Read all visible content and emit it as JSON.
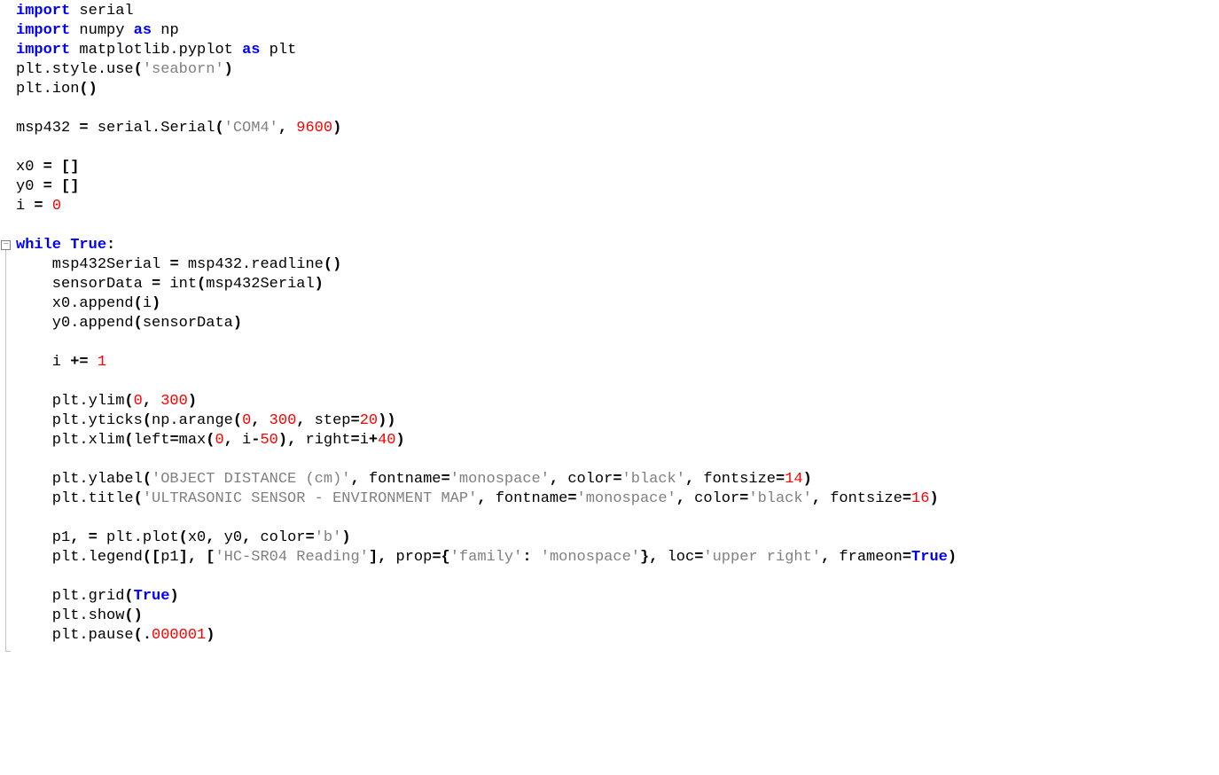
{
  "lines": [
    {
      "tokens": [
        {
          "t": "import",
          "c": "kw"
        },
        {
          "t": " serial",
          "c": "id"
        }
      ]
    },
    {
      "tokens": [
        {
          "t": "import",
          "c": "kw"
        },
        {
          "t": " numpy ",
          "c": "id"
        },
        {
          "t": "as",
          "c": "kw-as"
        },
        {
          "t": " np",
          "c": "id"
        }
      ]
    },
    {
      "tokens": [
        {
          "t": "import",
          "c": "kw"
        },
        {
          "t": " matplotlib.pyplot ",
          "c": "id"
        },
        {
          "t": "as",
          "c": "kw-as"
        },
        {
          "t": " plt",
          "c": "id"
        }
      ]
    },
    {
      "tokens": [
        {
          "t": "plt.style.use",
          "c": "id"
        },
        {
          "t": "(",
          "c": "punc"
        },
        {
          "t": "'seaborn'",
          "c": "str"
        },
        {
          "t": ")",
          "c": "punc"
        }
      ]
    },
    {
      "tokens": [
        {
          "t": "plt.ion",
          "c": "id"
        },
        {
          "t": "()",
          "c": "punc"
        }
      ]
    },
    {
      "tokens": []
    },
    {
      "tokens": [
        {
          "t": "msp432 ",
          "c": "id"
        },
        {
          "t": "=",
          "c": "punc"
        },
        {
          "t": " serial.Serial",
          "c": "id"
        },
        {
          "t": "(",
          "c": "punc"
        },
        {
          "t": "'COM4'",
          "c": "str"
        },
        {
          "t": ",",
          "c": "punc"
        },
        {
          "t": " ",
          "c": "id"
        },
        {
          "t": "9600",
          "c": "num"
        },
        {
          "t": ")",
          "c": "punc"
        }
      ]
    },
    {
      "tokens": []
    },
    {
      "tokens": [
        {
          "t": "x0 ",
          "c": "id"
        },
        {
          "t": "=",
          "c": "punc"
        },
        {
          "t": " ",
          "c": "id"
        },
        {
          "t": "[]",
          "c": "punc"
        }
      ]
    },
    {
      "tokens": [
        {
          "t": "y0 ",
          "c": "id"
        },
        {
          "t": "=",
          "c": "punc"
        },
        {
          "t": " ",
          "c": "id"
        },
        {
          "t": "[]",
          "c": "punc"
        }
      ]
    },
    {
      "tokens": [
        {
          "t": "i ",
          "c": "id"
        },
        {
          "t": "=",
          "c": "punc"
        },
        {
          "t": " ",
          "c": "id"
        },
        {
          "t": "0",
          "c": "num"
        }
      ]
    },
    {
      "tokens": []
    },
    {
      "fold": true,
      "tokens": [
        {
          "t": "while",
          "c": "kw"
        },
        {
          "t": " ",
          "c": "id"
        },
        {
          "t": "True",
          "c": "bool"
        },
        {
          "t": ":",
          "c": "punc"
        }
      ]
    },
    {
      "tokens": [
        {
          "t": "    msp432Serial ",
          "c": "id"
        },
        {
          "t": "=",
          "c": "punc"
        },
        {
          "t": " msp432.readline",
          "c": "id"
        },
        {
          "t": "()",
          "c": "punc"
        }
      ]
    },
    {
      "tokens": [
        {
          "t": "    sensorData ",
          "c": "id"
        },
        {
          "t": "=",
          "c": "punc"
        },
        {
          "t": " int",
          "c": "id"
        },
        {
          "t": "(",
          "c": "punc"
        },
        {
          "t": "msp432Serial",
          "c": "id"
        },
        {
          "t": ")",
          "c": "punc"
        }
      ]
    },
    {
      "tokens": [
        {
          "t": "    x0.append",
          "c": "id"
        },
        {
          "t": "(",
          "c": "punc"
        },
        {
          "t": "i",
          "c": "id"
        },
        {
          "t": ")",
          "c": "punc"
        }
      ]
    },
    {
      "tokens": [
        {
          "t": "    y0.append",
          "c": "id"
        },
        {
          "t": "(",
          "c": "punc"
        },
        {
          "t": "sensorData",
          "c": "id"
        },
        {
          "t": ")",
          "c": "punc"
        }
      ]
    },
    {
      "tokens": []
    },
    {
      "tokens": [
        {
          "t": "    i ",
          "c": "id"
        },
        {
          "t": "+=",
          "c": "punc"
        },
        {
          "t": " ",
          "c": "id"
        },
        {
          "t": "1",
          "c": "num"
        }
      ]
    },
    {
      "tokens": []
    },
    {
      "tokens": [
        {
          "t": "    plt.ylim",
          "c": "id"
        },
        {
          "t": "(",
          "c": "punc"
        },
        {
          "t": "0",
          "c": "num"
        },
        {
          "t": ",",
          "c": "punc"
        },
        {
          "t": " ",
          "c": "id"
        },
        {
          "t": "300",
          "c": "num"
        },
        {
          "t": ")",
          "c": "punc"
        }
      ]
    },
    {
      "tokens": [
        {
          "t": "    plt.yticks",
          "c": "id"
        },
        {
          "t": "(",
          "c": "punc"
        },
        {
          "t": "np.arange",
          "c": "id"
        },
        {
          "t": "(",
          "c": "punc"
        },
        {
          "t": "0",
          "c": "num"
        },
        {
          "t": ",",
          "c": "punc"
        },
        {
          "t": " ",
          "c": "id"
        },
        {
          "t": "300",
          "c": "num"
        },
        {
          "t": ",",
          "c": "punc"
        },
        {
          "t": " step",
          "c": "id"
        },
        {
          "t": "=",
          "c": "punc"
        },
        {
          "t": "20",
          "c": "num"
        },
        {
          "t": "))",
          "c": "punc"
        }
      ]
    },
    {
      "tokens": [
        {
          "t": "    plt.xlim",
          "c": "id"
        },
        {
          "t": "(",
          "c": "punc"
        },
        {
          "t": "left",
          "c": "id"
        },
        {
          "t": "=",
          "c": "punc"
        },
        {
          "t": "max",
          "c": "id"
        },
        {
          "t": "(",
          "c": "punc"
        },
        {
          "t": "0",
          "c": "num"
        },
        {
          "t": ",",
          "c": "punc"
        },
        {
          "t": " i",
          "c": "id"
        },
        {
          "t": "-",
          "c": "punc"
        },
        {
          "t": "50",
          "c": "num"
        },
        {
          "t": "),",
          "c": "punc"
        },
        {
          "t": " right",
          "c": "id"
        },
        {
          "t": "=",
          "c": "punc"
        },
        {
          "t": "i",
          "c": "id"
        },
        {
          "t": "+",
          "c": "punc"
        },
        {
          "t": "40",
          "c": "num"
        },
        {
          "t": ")",
          "c": "punc"
        }
      ]
    },
    {
      "tokens": []
    },
    {
      "tokens": [
        {
          "t": "    plt.ylabel",
          "c": "id"
        },
        {
          "t": "(",
          "c": "punc"
        },
        {
          "t": "'OBJECT DISTANCE (cm)'",
          "c": "str"
        },
        {
          "t": ",",
          "c": "punc"
        },
        {
          "t": " fontname",
          "c": "id"
        },
        {
          "t": "=",
          "c": "punc"
        },
        {
          "t": "'monospace'",
          "c": "str"
        },
        {
          "t": ",",
          "c": "punc"
        },
        {
          "t": " color",
          "c": "id"
        },
        {
          "t": "=",
          "c": "punc"
        },
        {
          "t": "'black'",
          "c": "str"
        },
        {
          "t": ",",
          "c": "punc"
        },
        {
          "t": " fontsize",
          "c": "id"
        },
        {
          "t": "=",
          "c": "punc"
        },
        {
          "t": "14",
          "c": "num"
        },
        {
          "t": ")",
          "c": "punc"
        }
      ]
    },
    {
      "tokens": [
        {
          "t": "    plt.title",
          "c": "id"
        },
        {
          "t": "(",
          "c": "punc"
        },
        {
          "t": "'ULTRASONIC SENSOR - ENVIRONMENT MAP'",
          "c": "str"
        },
        {
          "t": ",",
          "c": "punc"
        },
        {
          "t": " fontname",
          "c": "id"
        },
        {
          "t": "=",
          "c": "punc"
        },
        {
          "t": "'monospace'",
          "c": "str"
        },
        {
          "t": ",",
          "c": "punc"
        },
        {
          "t": " color",
          "c": "id"
        },
        {
          "t": "=",
          "c": "punc"
        },
        {
          "t": "'black'",
          "c": "str"
        },
        {
          "t": ",",
          "c": "punc"
        },
        {
          "t": " fontsize",
          "c": "id"
        },
        {
          "t": "=",
          "c": "punc"
        },
        {
          "t": "16",
          "c": "num"
        },
        {
          "t": ")",
          "c": "punc"
        }
      ]
    },
    {
      "tokens": []
    },
    {
      "tokens": [
        {
          "t": "    p1",
          "c": "id"
        },
        {
          "t": ",",
          "c": "punc"
        },
        {
          "t": " ",
          "c": "id"
        },
        {
          "t": "=",
          "c": "punc"
        },
        {
          "t": " plt.plot",
          "c": "id"
        },
        {
          "t": "(",
          "c": "punc"
        },
        {
          "t": "x0",
          "c": "id"
        },
        {
          "t": ",",
          "c": "punc"
        },
        {
          "t": " y0",
          "c": "id"
        },
        {
          "t": ",",
          "c": "punc"
        },
        {
          "t": " color",
          "c": "id"
        },
        {
          "t": "=",
          "c": "punc"
        },
        {
          "t": "'b'",
          "c": "str"
        },
        {
          "t": ")",
          "c": "punc"
        }
      ]
    },
    {
      "tokens": [
        {
          "t": "    plt.legend",
          "c": "id"
        },
        {
          "t": "([",
          "c": "punc"
        },
        {
          "t": "p1",
          "c": "id"
        },
        {
          "t": "],",
          "c": "punc"
        },
        {
          "t": " ",
          "c": "id"
        },
        {
          "t": "[",
          "c": "punc"
        },
        {
          "t": "'HC-SR04 Reading'",
          "c": "str"
        },
        {
          "t": "],",
          "c": "punc"
        },
        {
          "t": " prop",
          "c": "id"
        },
        {
          "t": "={",
          "c": "punc"
        },
        {
          "t": "'family'",
          "c": "str"
        },
        {
          "t": ":",
          "c": "punc"
        },
        {
          "t": " ",
          "c": "id"
        },
        {
          "t": "'monospace'",
          "c": "str"
        },
        {
          "t": "},",
          "c": "punc"
        },
        {
          "t": " loc",
          "c": "id"
        },
        {
          "t": "=",
          "c": "punc"
        },
        {
          "t": "'upper right'",
          "c": "str"
        },
        {
          "t": ",",
          "c": "punc"
        },
        {
          "t": " frameon",
          "c": "id"
        },
        {
          "t": "=",
          "c": "punc"
        },
        {
          "t": "True",
          "c": "bool"
        },
        {
          "t": ")",
          "c": "punc"
        }
      ]
    },
    {
      "tokens": []
    },
    {
      "tokens": [
        {
          "t": "    plt.grid",
          "c": "id"
        },
        {
          "t": "(",
          "c": "punc"
        },
        {
          "t": "True",
          "c": "bool"
        },
        {
          "t": ")",
          "c": "punc"
        }
      ]
    },
    {
      "tokens": [
        {
          "t": "    plt.show",
          "c": "id"
        },
        {
          "t": "()",
          "c": "punc"
        }
      ]
    },
    {
      "tokens": [
        {
          "t": "    plt.pause",
          "c": "id"
        },
        {
          "t": "(.",
          "c": "punc"
        },
        {
          "t": "000001",
          "c": "num"
        },
        {
          "t": ")",
          "c": "punc"
        }
      ]
    }
  ],
  "fold_marker_glyph": "−"
}
